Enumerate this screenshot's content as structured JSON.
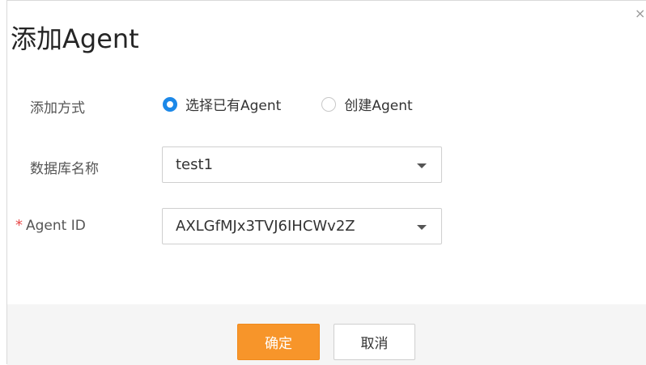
{
  "dialog": {
    "title": "添加Agent",
    "close_label": "×"
  },
  "form": {
    "add_mode": {
      "label": "添加方式",
      "options": [
        {
          "label": "选择已有Agent",
          "selected": true
        },
        {
          "label": "创建Agent",
          "selected": false
        }
      ]
    },
    "database_name": {
      "label": "数据库名称",
      "value": "test1"
    },
    "agent_id": {
      "required_mark": "*",
      "label": "Agent ID",
      "value": "AXLGfMJx3TVJ6IHCWv2Z"
    }
  },
  "footer": {
    "ok_label": "确定",
    "cancel_label": "取消"
  },
  "colors": {
    "accent": "#1c88e8",
    "primary_button": "#f7952a",
    "required": "#e84a4a",
    "footer_bg": "#f5f5f5"
  }
}
